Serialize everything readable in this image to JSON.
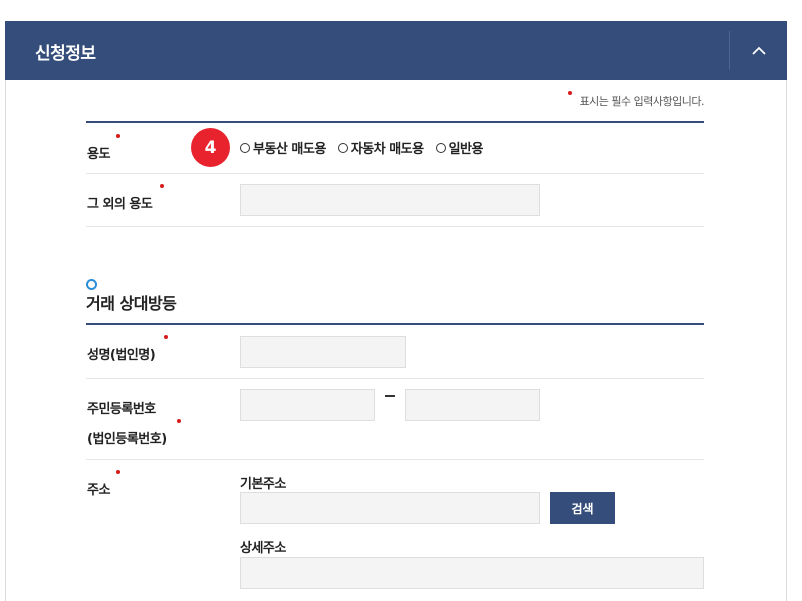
{
  "header": {
    "title": "신청정보",
    "collapse_icon": "chevron-up-icon"
  },
  "required_note": "표시는 필수 입력사항입니다.",
  "purpose": {
    "label": "용도",
    "step_badge": "4",
    "options": [
      "부동산 매도용",
      "자동차 매도용",
      "일반용"
    ]
  },
  "other_purpose": {
    "label": "그 외의 용도",
    "value": ""
  },
  "counterparty": {
    "section_title": "거래 상대방등",
    "name_label": "성명(법인명)",
    "id_label_line1": "주민등록번호",
    "id_label_line2": "(법인등록번호)",
    "address_label": "주소",
    "basic_address_label": "기본주소",
    "detail_address_label": "상세주소",
    "search_button": "검색"
  },
  "colors": {
    "header_bg": "#344d7a",
    "required_dot": "#d61b1b",
    "step_badge": "#e8232d",
    "section_ring": "#2a8ed8"
  }
}
